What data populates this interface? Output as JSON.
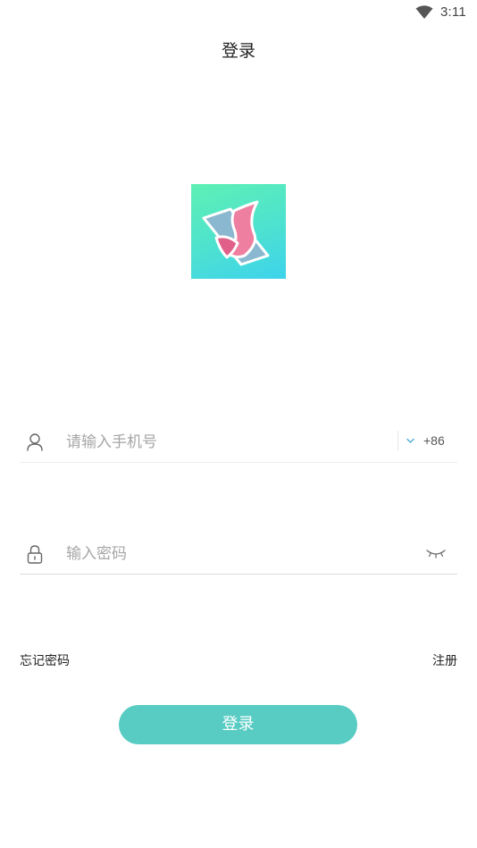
{
  "status_bar": {
    "time": "3:11",
    "wifi_icon": "wifi-icon"
  },
  "header": {
    "title": "登录"
  },
  "logo": {
    "icon": "app-logo",
    "gradient_colors": [
      "#5ef0b4",
      "#3dd3ec"
    ],
    "mark_colors": [
      "#ef7fa0",
      "#8ab8d0",
      "#e0608a"
    ]
  },
  "phone_field": {
    "icon": "user-icon",
    "placeholder": "请输入手机号",
    "value": "",
    "country_code": "+86",
    "dropdown_icon": "chevron-down-icon"
  },
  "password_field": {
    "icon": "lock-icon",
    "placeholder": "输入密码",
    "value": "",
    "toggle_icon": "eye-closed-icon"
  },
  "links": {
    "forgot_password": "忘记密码",
    "register": "注册"
  },
  "login_button": {
    "label": "登录",
    "color": "#58cbc3"
  }
}
